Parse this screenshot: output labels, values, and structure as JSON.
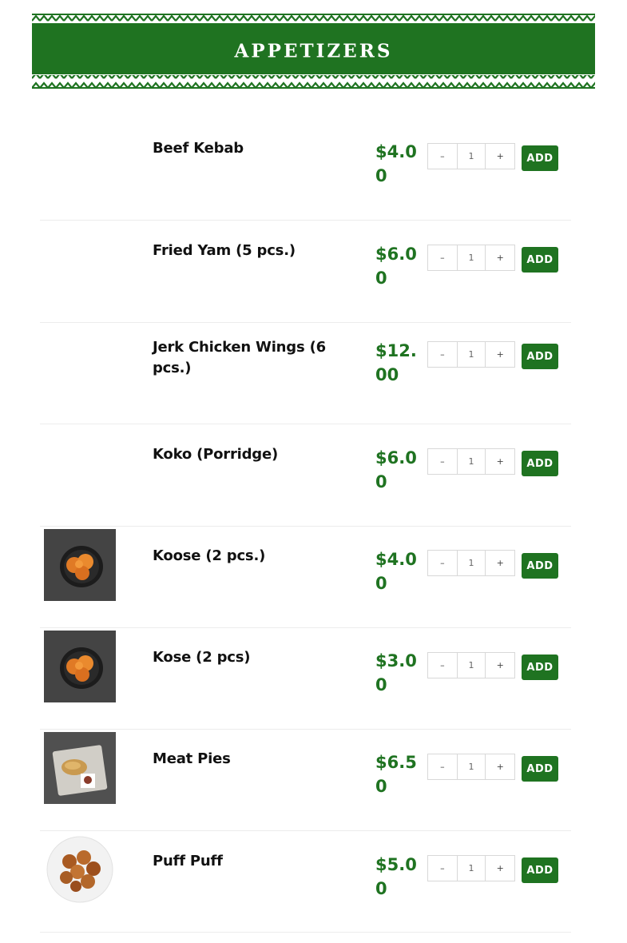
{
  "section": {
    "title": "APPETIZERS",
    "colors": {
      "brand_green": "#1f7321",
      "text": "#111111",
      "background": "#ffffff"
    }
  },
  "quantity_controls": {
    "minus": "–",
    "plus": "+"
  },
  "items": [
    {
      "name": "Beef Kebab",
      "price": "$4.00",
      "qty": "1",
      "add_label": "ADD",
      "image": null
    },
    {
      "name": "Fried Yam (5 pcs.)",
      "price": "$6.00",
      "qty": "1",
      "add_label": "ADD",
      "image": null
    },
    {
      "name": "Jerk Chicken Wings (6 pcs.)",
      "price": "$12.00",
      "qty": "1",
      "add_label": "ADD",
      "image": null
    },
    {
      "name": "Koko (Porridge)",
      "price": "$6.00",
      "qty": "1",
      "add_label": "ADD",
      "image": null
    },
    {
      "name": "Koose (2 pcs.)",
      "price": "$4.00",
      "qty": "1",
      "add_label": "ADD",
      "image": "fritters-in-bowl"
    },
    {
      "name": "Kose (2 pcs)",
      "price": "$3.00",
      "qty": "1",
      "add_label": "ADD",
      "image": "fritters-in-bowl"
    },
    {
      "name": "Meat Pies",
      "price": "$6.50",
      "qty": "1",
      "add_label": "ADD",
      "image": "packaged-meat-pie"
    },
    {
      "name": "Puff Puff",
      "price": "$5.00",
      "qty": "1",
      "add_label": "ADD",
      "image": "puff-puff-plate"
    }
  ]
}
